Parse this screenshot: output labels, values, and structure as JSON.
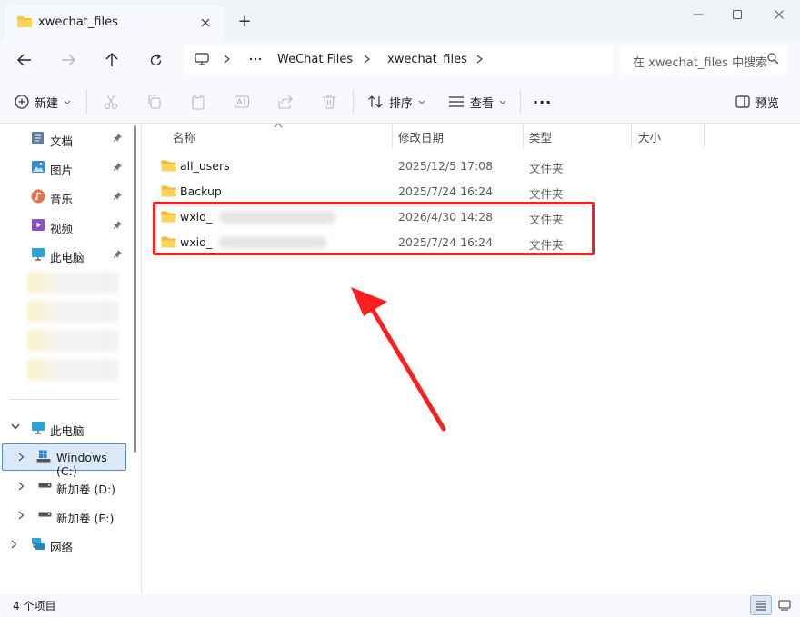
{
  "window": {
    "tab_title": "xwechat_files",
    "new_tab": "+",
    "colors": {
      "accent": "#0f6cbd",
      "folder": "#f8c33d",
      "highlight": "#ff1d1d"
    }
  },
  "navigation": {
    "breadcrumb": [
      "WeChat Files",
      "xwechat_files"
    ],
    "search_placeholder": "在 xwechat_files 中搜索"
  },
  "toolbar": {
    "new_label": "新建",
    "sort_label": "排序",
    "view_label": "查看",
    "more_label": "···",
    "preview_label": "预览"
  },
  "sidebar": {
    "quick_access": [
      {
        "label": "文档",
        "icon": "documents-icon"
      },
      {
        "label": "图片",
        "icon": "pictures-icon"
      },
      {
        "label": "音乐",
        "icon": "music-icon"
      },
      {
        "label": "视频",
        "icon": "videos-icon"
      },
      {
        "label": "此电脑",
        "icon": "computer-icon"
      }
    ],
    "this_pc": "此电脑",
    "drives": [
      {
        "label": "Windows (C:)",
        "icon": "windows-drive-icon"
      },
      {
        "label": "新加卷 (D:)",
        "icon": "drive-icon"
      },
      {
        "label": "新加卷 (E:)",
        "icon": "drive-icon"
      }
    ],
    "network": "网络"
  },
  "columns": {
    "name": "名称",
    "date": "修改日期",
    "type": "类型",
    "size": "大小"
  },
  "files": [
    {
      "name": "all_users",
      "date": "2025/12/5 17:08",
      "type": "文件夹"
    },
    {
      "name": "Backup",
      "date": "2025/7/24 16:24",
      "type": "文件夹"
    },
    {
      "name": "wxid_",
      "date": "2026/4/30 14:28",
      "type": "文件夹"
    },
    {
      "name": "wxid_",
      "date": "2025/7/24 16:24",
      "type": "文件夹"
    }
  ],
  "status": {
    "item_count": "4 个项目"
  }
}
